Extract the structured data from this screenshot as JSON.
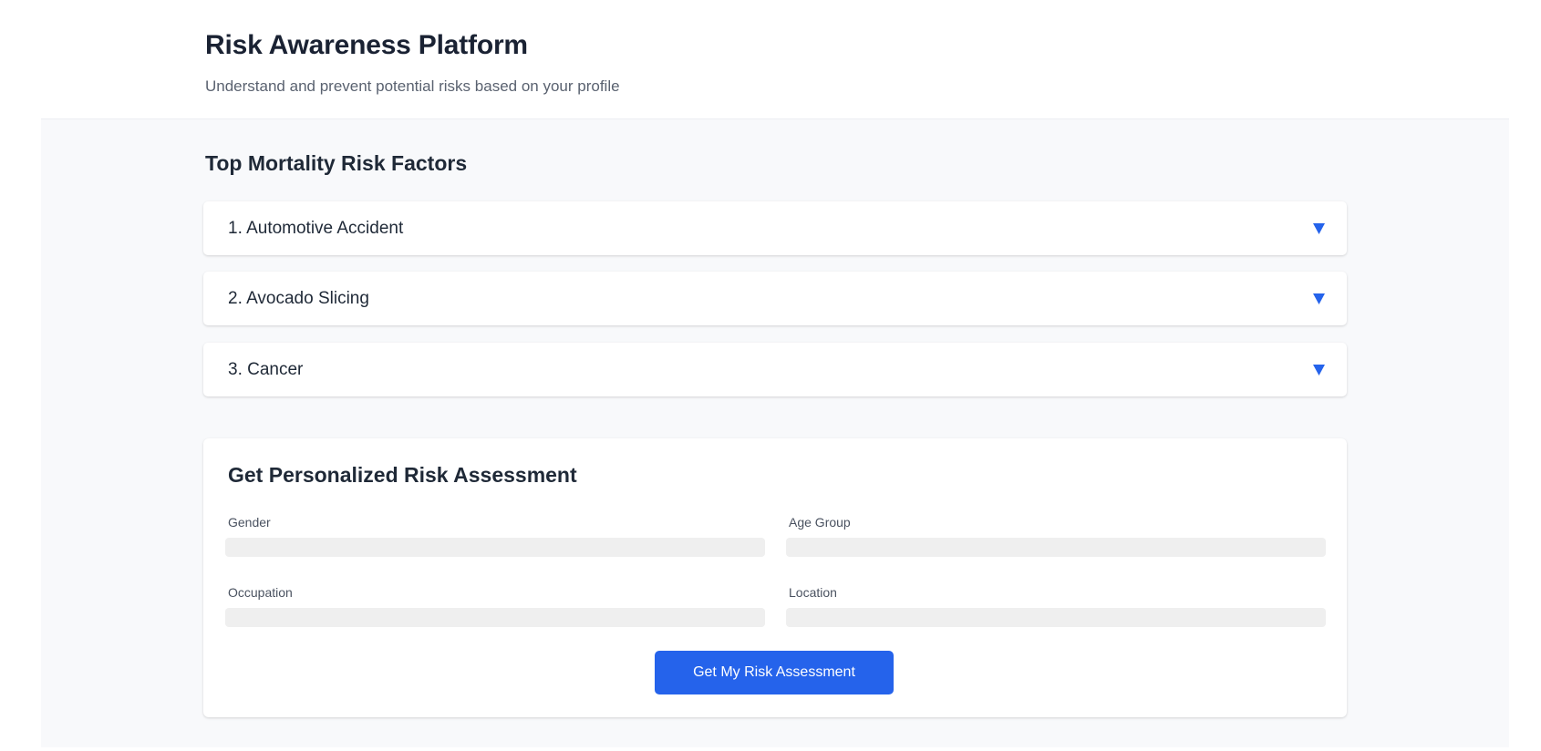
{
  "header": {
    "title": "Risk Awareness Platform",
    "subtitle": "Understand and prevent potential risks based on your profile"
  },
  "risks": {
    "section_title": "Top Mortality Risk Factors",
    "expand_icon": "chevron-down-icon",
    "items": [
      {
        "label": "1. Automotive Accident"
      },
      {
        "label": "2. Avocado Slicing"
      },
      {
        "label": "3. Cancer"
      }
    ]
  },
  "assessment": {
    "title": "Get Personalized Risk Assessment",
    "fields": {
      "gender": {
        "label": "Gender",
        "value": ""
      },
      "age_group": {
        "label": "Age Group",
        "value": ""
      },
      "occupation": {
        "label": "Occupation",
        "value": ""
      },
      "location": {
        "label": "Location",
        "value": ""
      }
    },
    "submit_label": "Get My Risk Assessment"
  },
  "colors": {
    "accent": "#2563eb",
    "page_background": "#f8f9fb",
    "card_background": "#ffffff",
    "input_background": "#efefef"
  }
}
